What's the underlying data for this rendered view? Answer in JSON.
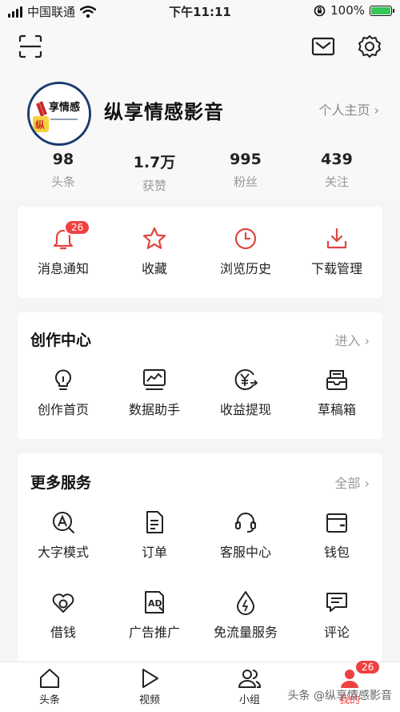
{
  "status_bar": {
    "carrier": "中国联通",
    "time": "下午11:11",
    "battery": "100%",
    "battery_level": 1.0
  },
  "profile": {
    "name": "纵享情感影音",
    "homepage_link": "个人主页 ›"
  },
  "stats": [
    {
      "value": "98",
      "label": "头条"
    },
    {
      "value": "1.7万",
      "label": "获赞"
    },
    {
      "value": "995",
      "label": "粉丝"
    },
    {
      "value": "439",
      "label": "关注"
    }
  ],
  "quick_actions": [
    {
      "label": "消息通知",
      "icon": "bell-icon",
      "badge": "26"
    },
    {
      "label": "收藏",
      "icon": "star-icon"
    },
    {
      "label": "浏览历史",
      "icon": "clock-icon"
    },
    {
      "label": "下载管理",
      "icon": "download-icon"
    }
  ],
  "creation_center": {
    "title": "创作中心",
    "more": "进入 ›",
    "items": [
      {
        "label": "创作首页",
        "icon": "lightbulb-icon"
      },
      {
        "label": "数据助手",
        "icon": "chart-monitor-icon"
      },
      {
        "label": "收益提现",
        "icon": "yen-icon"
      },
      {
        "label": "草稿箱",
        "icon": "drafts-icon"
      }
    ]
  },
  "more_services": {
    "title": "更多服务",
    "more": "全部 ›",
    "items": [
      {
        "label": "大字模式",
        "icon": "font-size-icon"
      },
      {
        "label": "订单",
        "icon": "order-icon"
      },
      {
        "label": "客服中心",
        "icon": "headset-icon"
      },
      {
        "label": "钱包",
        "icon": "wallet-icon"
      },
      {
        "label": "借钱",
        "icon": "loan-icon"
      },
      {
        "label": "广告推广",
        "icon": "ad-icon"
      },
      {
        "label": "免流量服务",
        "icon": "data-drop-icon"
      },
      {
        "label": "评论",
        "icon": "comment-icon"
      }
    ]
  },
  "tabbar": {
    "tabs": [
      {
        "label": "头条",
        "icon": "home-icon"
      },
      {
        "label": "视频",
        "icon": "play-icon"
      },
      {
        "label": "小组",
        "icon": "group-icon"
      },
      {
        "label": "我的",
        "icon": "profile-icon",
        "badge": "26"
      }
    ]
  },
  "watermark": "头条 @纵享情感影音",
  "colors": {
    "accent": "#e0463e",
    "badge": "#f04142",
    "battery": "#34c759",
    "background": "#f5f5f5"
  }
}
